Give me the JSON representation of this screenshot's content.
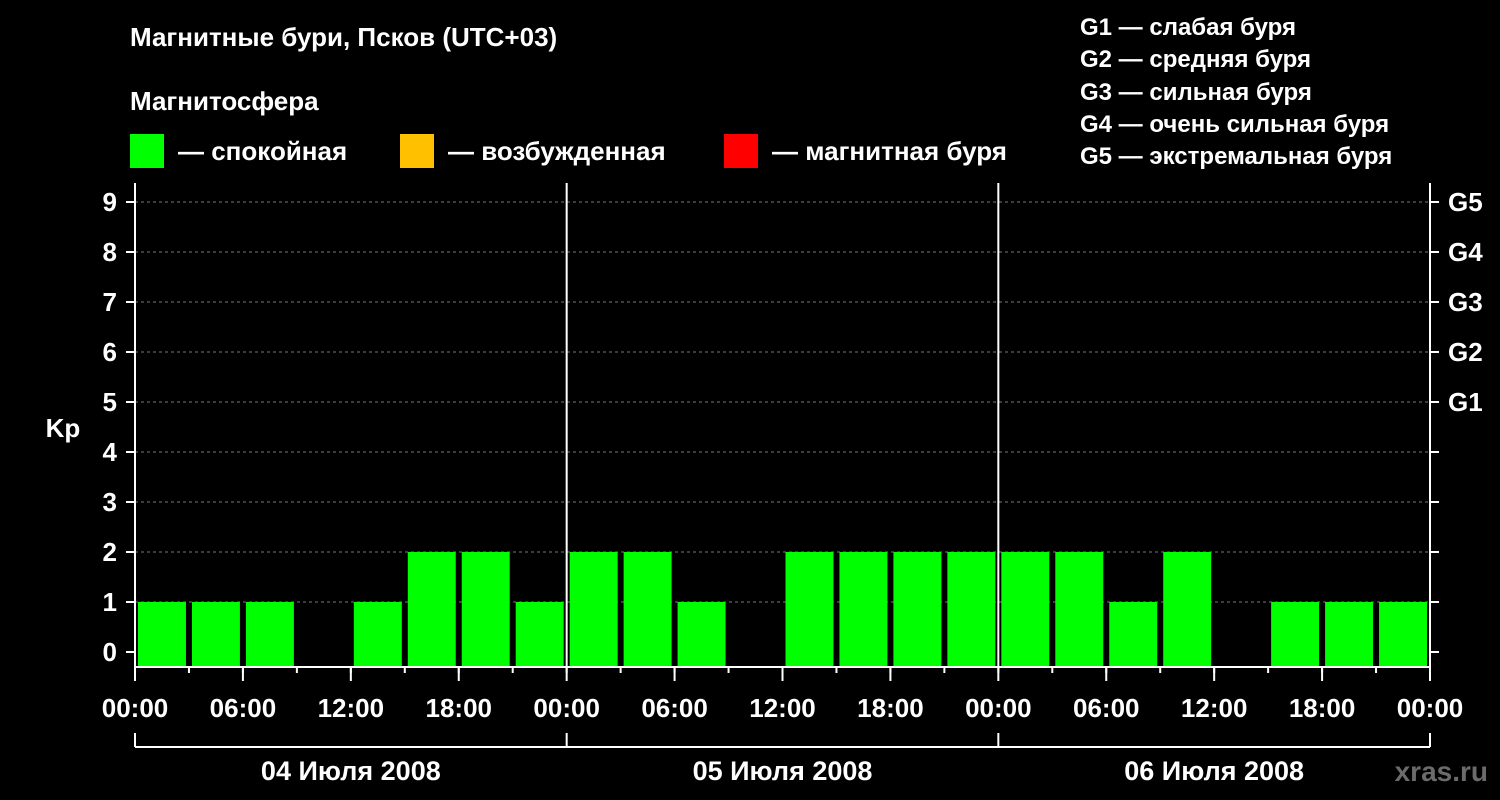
{
  "header": {
    "title": "Магнитные бури, Псков (UTC+03)",
    "subtitle": "Магнитосфера"
  },
  "legend": [
    {
      "label": "— спокойная",
      "color": "#00ff00"
    },
    {
      "label": "— возбужденная",
      "color": "#ffc000"
    },
    {
      "label": "— магнитная буря",
      "color": "#ff0000"
    }
  ],
  "g_scale": [
    "G1 — слабая буря",
    "G2 — средняя буря",
    "G3 — сильная буря",
    "G4 — очень сильная буря",
    "G5 — экстремальная буря"
  ],
  "watermark": "xras.ru",
  "chart_data": {
    "type": "bar",
    "ylabel": "Kp",
    "ylim": [
      0,
      9
    ],
    "y_ticks": [
      "0",
      "1",
      "2",
      "3",
      "4",
      "5",
      "6",
      "7",
      "8",
      "9"
    ],
    "right_ticks": [
      {
        "value": 5,
        "label": "G1"
      },
      {
        "value": 6,
        "label": "G2"
      },
      {
        "value": 7,
        "label": "G3"
      },
      {
        "value": 8,
        "label": "G4"
      },
      {
        "value": 9,
        "label": "G5"
      }
    ],
    "grid": "dashed horizontal",
    "x_tick_labels": [
      "00:00",
      "06:00",
      "12:00",
      "18:00",
      "00:00",
      "06:00",
      "12:00",
      "18:00",
      "00:00",
      "06:00",
      "12:00",
      "18:00",
      "00:00"
    ],
    "days": [
      "04 Июля 2008",
      "05 Июля 2008",
      "06 Июля 2008"
    ],
    "series": [
      {
        "values": [
          1,
          1,
          1,
          0,
          1,
          2,
          2,
          1,
          2,
          2,
          1,
          0,
          2,
          2,
          2,
          2,
          2,
          2,
          1,
          2,
          0,
          1,
          1,
          1
        ],
        "color": "#00ff00"
      }
    ]
  }
}
